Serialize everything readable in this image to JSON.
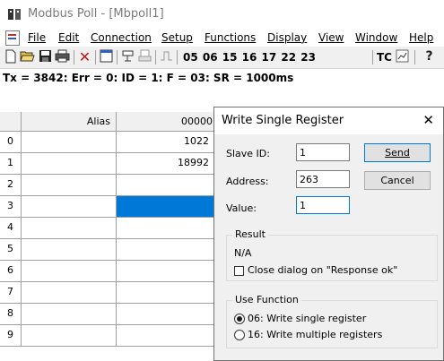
{
  "window": {
    "app_icon": "modbus-poll-icon",
    "title": "Modbus Poll - [Mbpoll1]"
  },
  "menu": {
    "items": [
      "File",
      "Edit",
      "Connection",
      "Setup",
      "Functions",
      "Display",
      "View",
      "Window",
      "Help"
    ]
  },
  "toolbar": {
    "icons": [
      "new-icon",
      "open-icon",
      "save-icon",
      "print-icon",
      "delete-icon",
      "window-icon",
      "connect-icon",
      "print-preview-icon",
      "pulse-icon"
    ],
    "function_codes": "05 06 15 16 17 22 23",
    "tc_label": "TC",
    "extra_icons": [
      "chart-icon",
      "help-icon"
    ]
  },
  "status": "Tx = 3842: Err = 0: ID = 1: F = 03: SR = 1000ms",
  "grid": {
    "columns": [
      "",
      "Alias",
      "00000"
    ],
    "rows": [
      {
        "num": "0",
        "alias": "",
        "value": "1022"
      },
      {
        "num": "1",
        "alias": "",
        "value": "18992"
      },
      {
        "num": "2",
        "alias": "",
        "value": ""
      },
      {
        "num": "3",
        "alias": "",
        "value": ""
      },
      {
        "num": "4",
        "alias": "",
        "value": ""
      },
      {
        "num": "5",
        "alias": "",
        "value": ""
      },
      {
        "num": "6",
        "alias": "",
        "value": ""
      },
      {
        "num": "7",
        "alias": "",
        "value": ""
      },
      {
        "num": "8",
        "alias": "",
        "value": ""
      },
      {
        "num": "9",
        "alias": "",
        "value": ""
      }
    ],
    "selected_row": 3,
    "selection_color": "#0078d7"
  },
  "dialog": {
    "title": "Write Single Register",
    "slave_id_label": "Slave ID:",
    "slave_id": "1",
    "address_label": "Address:",
    "address": "263",
    "value_label": "Value:",
    "value": "1",
    "send_label": "Send",
    "cancel_label": "Cancel",
    "result_label": "Result",
    "result_value": "N/A",
    "close_on_ok_label": "Close dialog on \"Response ok\"",
    "close_on_ok_checked": false,
    "use_function_label": "Use Function",
    "function_options": [
      "06: Write single register",
      "16: Write multiple registers"
    ],
    "selected_function": 0
  }
}
